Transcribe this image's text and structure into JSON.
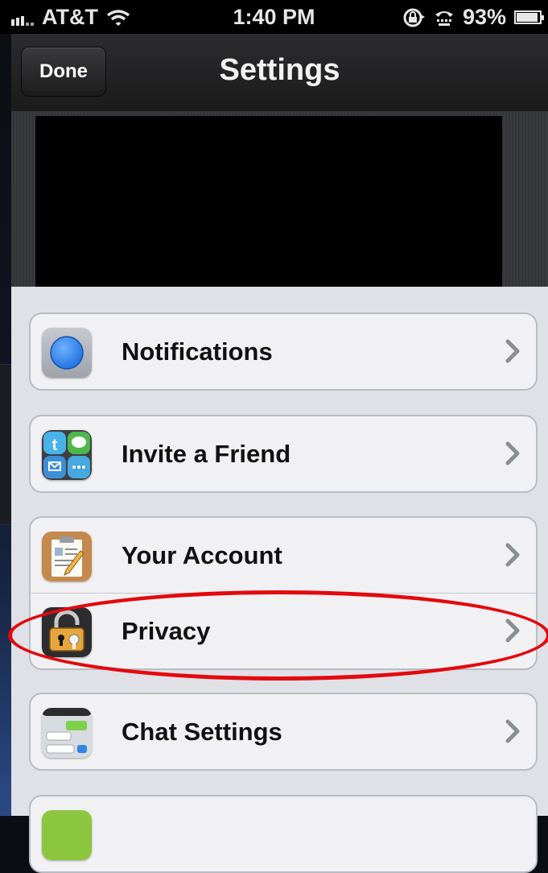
{
  "status_bar": {
    "carrier": "AT&T",
    "time": "1:40 PM",
    "battery": "93%",
    "battery_level": 0.93,
    "icons": [
      "signal-icon",
      "wifi-icon",
      "rotation-lock-icon",
      "tty-icon",
      "battery-icon"
    ]
  },
  "nav": {
    "done_label": "Done",
    "title": "Settings"
  },
  "settings": {
    "items": [
      {
        "label": "Notifications",
        "icon": "notifications-icon"
      },
      {
        "label": "Invite a Friend",
        "icon": "invite-friend-icon"
      },
      {
        "label": "Your Account",
        "icon": "account-icon"
      },
      {
        "label": "Privacy",
        "icon": "privacy-lock-icon"
      },
      {
        "label": "Chat Settings",
        "icon": "chat-settings-icon"
      },
      {
        "label": "",
        "icon": "partial-item-icon"
      }
    ]
  },
  "colors": {
    "highlight": "#e3090d",
    "list_bg": "#dfe1e7",
    "cell_bg": "#f1f1f3"
  }
}
